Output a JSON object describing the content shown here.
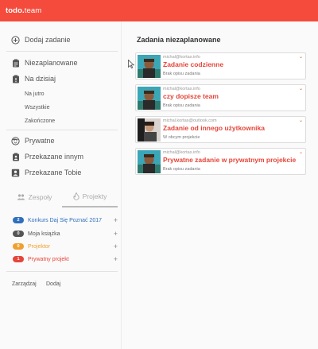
{
  "app": {
    "logo_main": "todo.",
    "logo_accent": "team"
  },
  "sidebar": {
    "add_task": "Dodaj zadanie",
    "unscheduled": "Niezaplanowane",
    "today": "Na dzisiaj",
    "tomorrow": "Na jutro",
    "all": "Wszystkie",
    "finished": "Zakończone",
    "private": "Prywatne",
    "delegated_to_others": "Przekazane innym",
    "delegated_to_you": "Przekazane Tobie",
    "tab_teams": "Zespoły",
    "tab_projects": "Projekty",
    "projects": [
      {
        "count": "2",
        "name": "Konkurs Daj Się Poznać 2017",
        "color": "#2f6fbf",
        "badge": "#2f6fbf"
      },
      {
        "count": "0",
        "name": "Moja książka",
        "color": "#555555",
        "badge": "#555555"
      },
      {
        "count": "0",
        "name": "Projektor",
        "color": "#f0a030",
        "badge": "#f0a030"
      },
      {
        "count": "1",
        "name": "Prywatny projekt",
        "color": "#e5463a",
        "badge": "#e5463a"
      }
    ],
    "plus": "+",
    "manage": "Zarządzaj",
    "add": "Dodaj"
  },
  "main": {
    "title": "Zadania niezaplanowane",
    "cards": [
      {
        "meta": "michal@kortas.info",
        "title": "Zadanie codzienne",
        "desc": "Brak opisu zadania"
      },
      {
        "meta": "michal@kortas.info",
        "title": "czy dopisze team",
        "desc": "Brak opisu zadania"
      },
      {
        "meta": "michal.kortas@outlook.com",
        "title": "Zadanie od innego użytkownika",
        "desc": "W obcym projekcie"
      },
      {
        "meta": "michal@kortas.info",
        "title": "Prywatne zadanie w prywatnym projekcie",
        "desc": "Brak opisu zadania"
      }
    ],
    "chevron": "⌄"
  }
}
